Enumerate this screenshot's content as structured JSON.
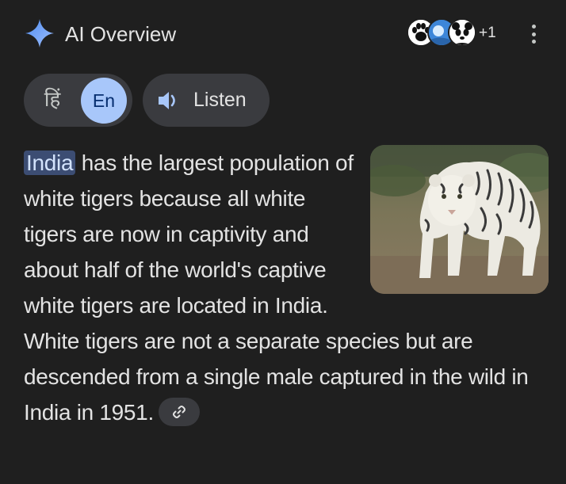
{
  "header": {
    "title": "AI Overview",
    "source_count": "+1",
    "sparkle_icon": "gemini-sparkle-icon",
    "more_icon": "more-vertical-icon"
  },
  "controls": {
    "lang_hindi": "हिं",
    "lang_english": "En",
    "listen_label": "Listen",
    "listen_icon": "speaker-icon"
  },
  "content": {
    "highlight": "India",
    "text_1": " has the largest population of white tigers because all white tigers are now in captivity and about half of the world's captive white tigers are located in India. White tigers are not a separate species but are descended from a single male captured in the wild in India in 1951.",
    "link_icon": "link-icon"
  },
  "colors": {
    "background": "#1f1f1f",
    "chip_bg": "#3a3b3f",
    "accent_blue": "#a8c7fa",
    "highlight_bg": "#3c4d73",
    "text": "#e3e3e3"
  }
}
